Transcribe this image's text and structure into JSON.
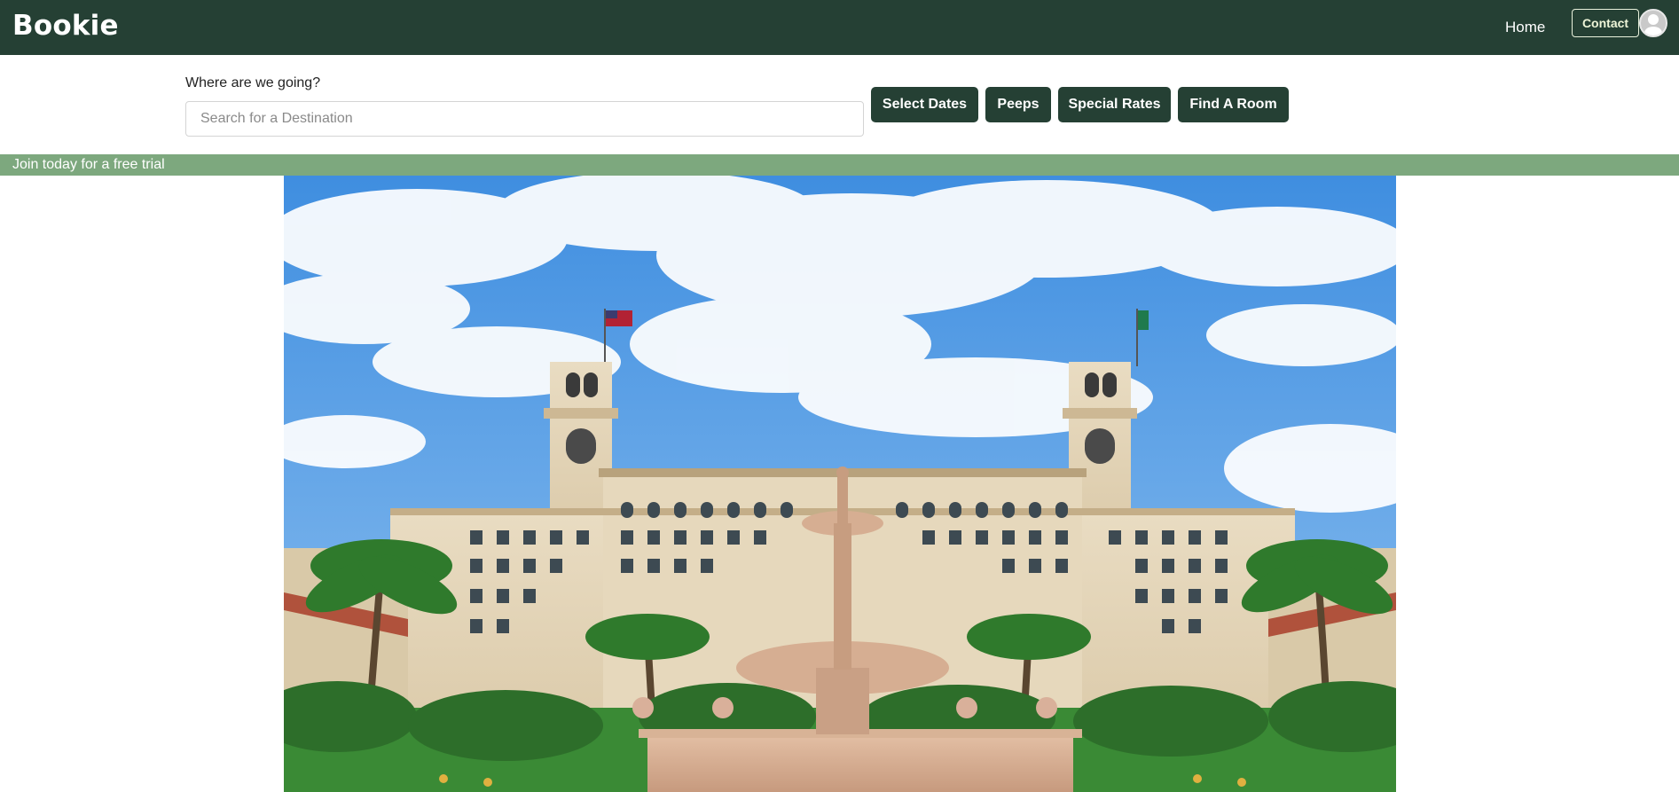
{
  "navbar": {
    "brand": "Bookie",
    "home_label": "Home",
    "contact_label": "Contact",
    "avatar_icon": "user-avatar-icon"
  },
  "search": {
    "label": "Where are we going?",
    "placeholder": "Search for a Destination",
    "value": ""
  },
  "actions": {
    "select_dates": "Select Dates",
    "peeps": "Peeps",
    "special_rates": "Special Rates",
    "find_room": "Find A Room"
  },
  "promo": {
    "text": "Join today for a free trial"
  },
  "colors": {
    "primary": "#254034",
    "banner": "#7da87e"
  }
}
